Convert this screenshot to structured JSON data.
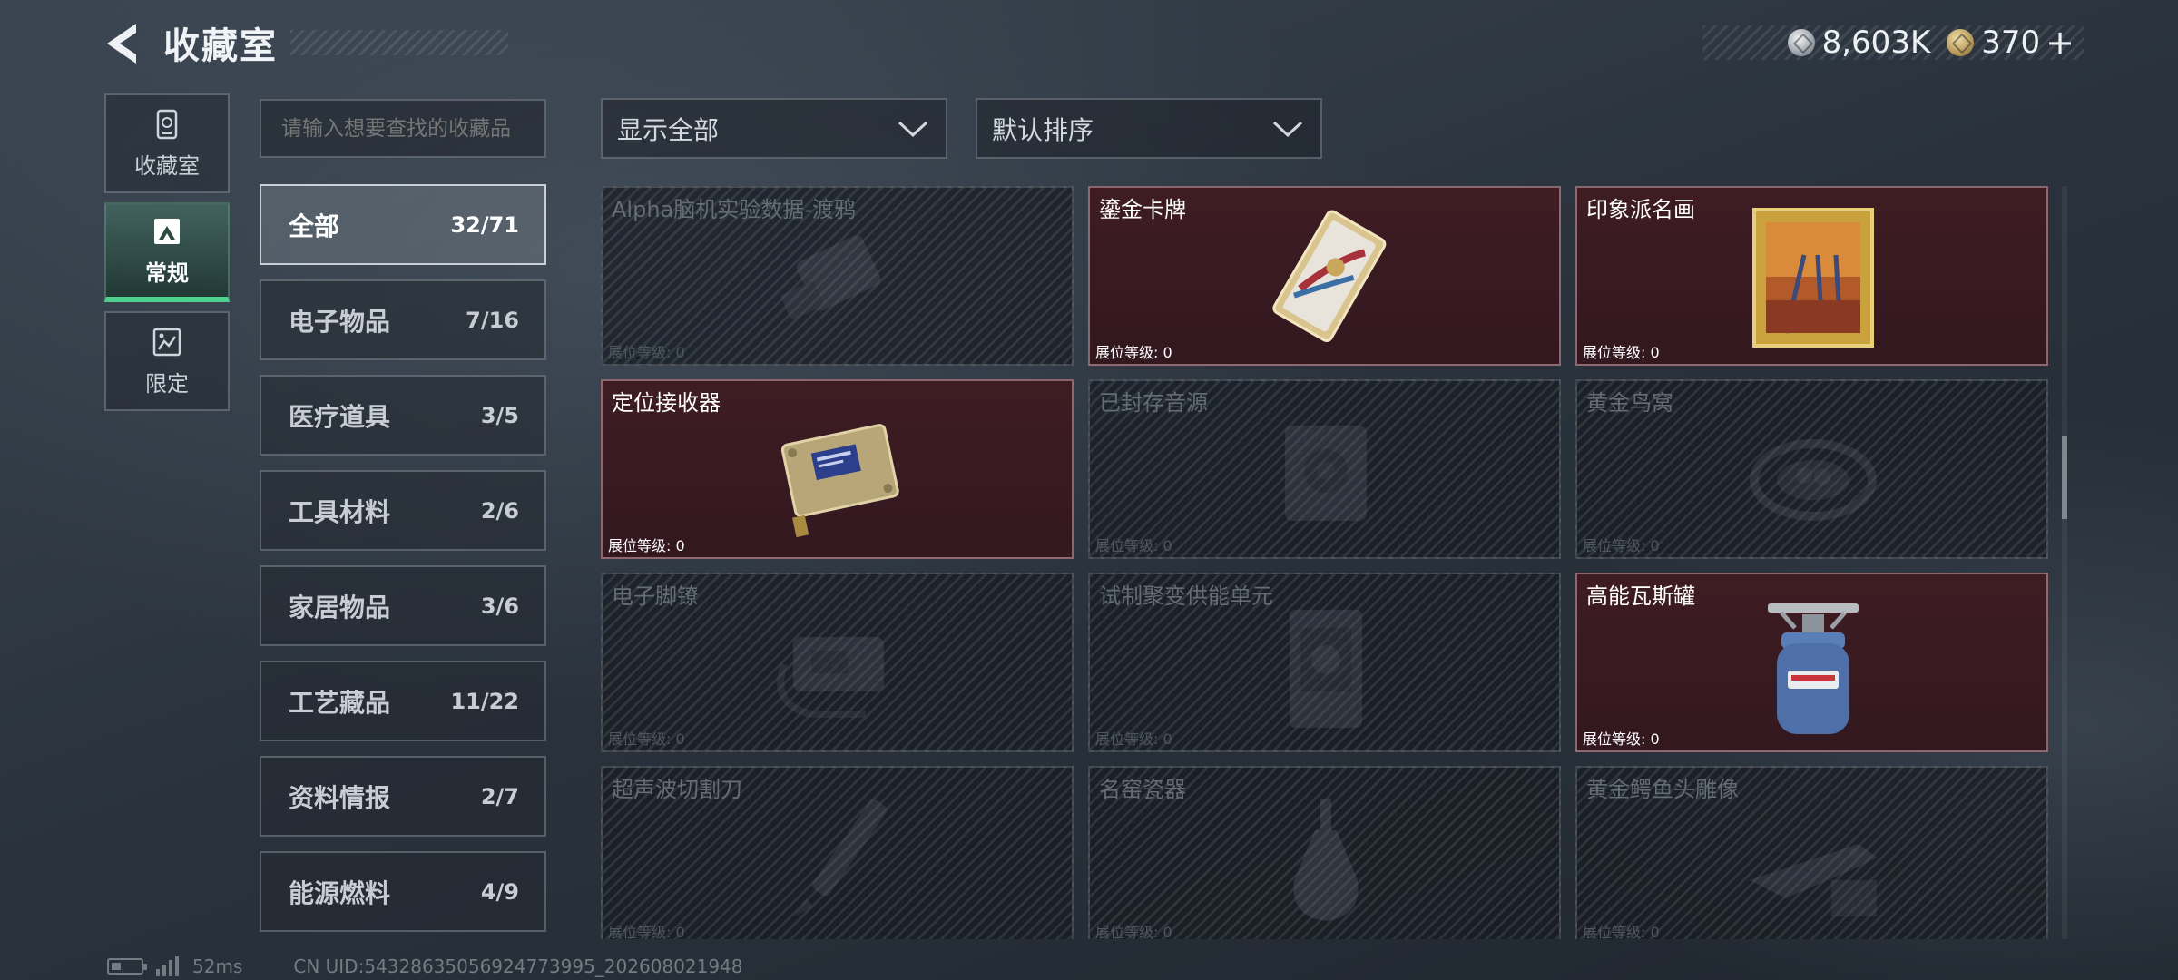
{
  "header": {
    "title": "收藏室",
    "currency": [
      {
        "icon": "silver-coin-icon",
        "value": "8,603K"
      },
      {
        "icon": "gold-coin-icon",
        "value": "370"
      }
    ],
    "add_label": "+"
  },
  "leftnav": {
    "items": [
      {
        "label": "收藏室",
        "icon": "collection-room-icon",
        "active": false
      },
      {
        "label": "常规",
        "icon": "regular-icon",
        "active": true
      },
      {
        "label": "限定",
        "icon": "limited-icon",
        "active": false
      }
    ]
  },
  "search": {
    "placeholder": "请输入想要查找的收藏品"
  },
  "categories": [
    {
      "name": "全部",
      "count": "32/71",
      "active": true
    },
    {
      "name": "电子物品",
      "count": "7/16"
    },
    {
      "name": "医疗道具",
      "count": "3/5"
    },
    {
      "name": "工具材料",
      "count": "2/6"
    },
    {
      "name": "家居物品",
      "count": "3/6"
    },
    {
      "name": "工艺藏品",
      "count": "11/22"
    },
    {
      "name": "资料情报",
      "count": "2/7"
    },
    {
      "name": "能源燃料",
      "count": "4/9"
    }
  ],
  "filters": {
    "display": "显示全部",
    "sort": "默认排序"
  },
  "items": [
    {
      "title": "Alpha脑机实验数据-渡鸦",
      "level": "展位等级: 0",
      "owned": false
    },
    {
      "title": "鎏金卡牌",
      "level": "展位等级: 0",
      "owned": true
    },
    {
      "title": "印象派名画",
      "level": "展位等级: 0",
      "owned": true
    },
    {
      "title": "定位接收器",
      "level": "展位等级: 0",
      "owned": true
    },
    {
      "title": "已封存音源",
      "level": "展位等级: 0",
      "owned": false
    },
    {
      "title": "黄金鸟窝",
      "level": "展位等级: 0",
      "owned": false
    },
    {
      "title": "电子脚镣",
      "level": "展位等级: 0",
      "owned": false
    },
    {
      "title": "试制聚变供能单元",
      "level": "展位等级: 0",
      "owned": false
    },
    {
      "title": "高能瓦斯罐",
      "level": "展位等级: 0",
      "owned": true
    },
    {
      "title": "超声波切割刀",
      "level": "展位等级: 0",
      "owned": false
    },
    {
      "title": "名窑瓷器",
      "level": "展位等级: 0",
      "owned": false
    },
    {
      "title": "黄金鳄鱼头雕像",
      "level": "展位等级: 0",
      "owned": false
    }
  ],
  "footer": {
    "ping": "52ms",
    "uid": "CN UID:54328635056924773995_202608021948"
  },
  "colors": {
    "accent_green": "#4fd18d",
    "owned_card_bg": "#3e1c22",
    "locked_card_bg": "#161b21"
  }
}
